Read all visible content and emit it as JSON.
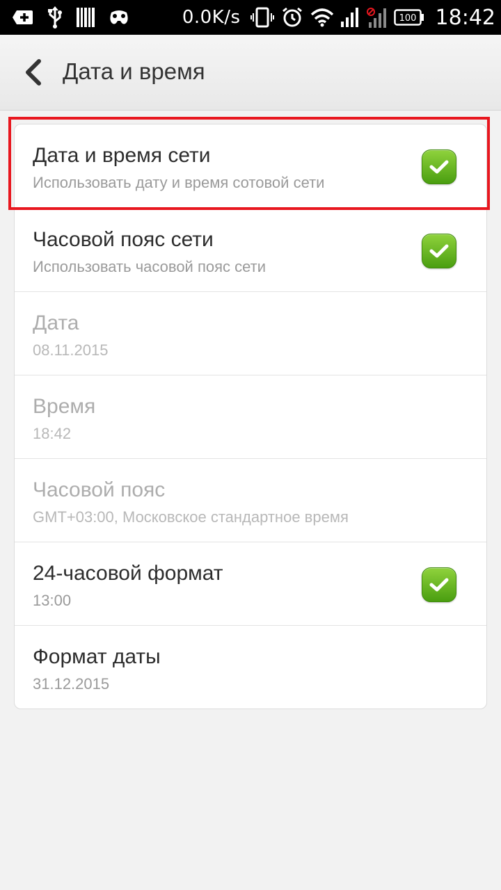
{
  "status_bar": {
    "net_speed": "0.0K/s",
    "battery": "100",
    "time": "18:42",
    "left_icons": [
      "add-icon",
      "usb-icon",
      "barcode-icon",
      "gamepad-icon"
    ],
    "right_icons": [
      "vibrate-icon",
      "alarm-icon",
      "wifi-icon",
      "signal-icon",
      "signal-blocked-icon",
      "battery-icon"
    ]
  },
  "action_bar": {
    "title": "Дата и время",
    "back_icon": "chevron-left-icon"
  },
  "settings": [
    {
      "title": "Дата и время сети",
      "subtitle": "Использовать дату и время сотовой сети",
      "checked": true,
      "enabled": true
    },
    {
      "title": "Часовой пояс сети",
      "subtitle": "Использовать часовой пояс сети",
      "checked": true,
      "enabled": true
    },
    {
      "title": "Дата",
      "subtitle": "08.11.2015",
      "checked": false,
      "enabled": false
    },
    {
      "title": "Время",
      "subtitle": "18:42",
      "checked": false,
      "enabled": false
    },
    {
      "title": "Часовой пояс",
      "subtitle": "GMT+03:00, Московское стандартное время",
      "checked": false,
      "enabled": false
    },
    {
      "title": "24-часовой формат",
      "subtitle": "13:00",
      "checked": true,
      "enabled": true
    },
    {
      "title": "Формат даты",
      "subtitle": "31.12.2015",
      "checked": false,
      "enabled": true
    }
  ],
  "colors": {
    "checkbox_green": "#5bb31c",
    "highlight_red": "#e8171f",
    "status_bar_bg": "#000000"
  }
}
